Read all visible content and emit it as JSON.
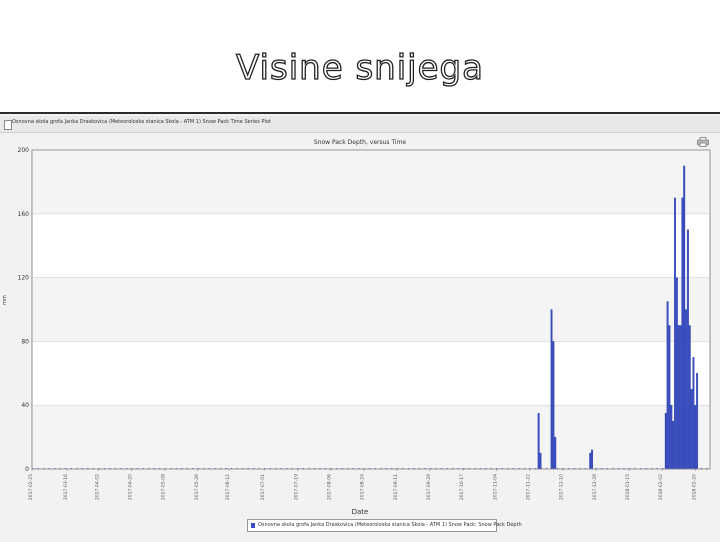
{
  "slide": {
    "title": "Visine snijega"
  },
  "window": {
    "title": "Osnovna skola grofa Janka Draskovica (Meteoroloska stanica Skola - ATM 1) Snow Pack Time Series Plot"
  },
  "colors": {
    "bar": "#3a4fc7",
    "grid": "#dcdcdc",
    "band": "#f4f4f4"
  },
  "icons": {
    "print": "print-icon",
    "window": "document-icon"
  },
  "chart_data": {
    "type": "bar",
    "title": "Snow Pack Depth, versus Time",
    "xlabel": "Date",
    "ylabel": "mm",
    "ylim": [
      0,
      200
    ],
    "yticks": [
      0,
      40,
      80,
      120,
      160,
      200
    ],
    "grid": true,
    "legend_position": "bottom-center",
    "xlim": [
      "2017-02-25",
      "2018-02-28"
    ],
    "xtick_labels": [
      "2017-02-25",
      "2017-03-16",
      "2017-04-02",
      "2017-04-20",
      "2017-05-08",
      "2017-05-26",
      "2017-06-12",
      "2017-07-01",
      "2017-07-19",
      "2017-08-06",
      "2017-08-24",
      "2017-09-11",
      "2017-09-29",
      "2017-10-17",
      "2017-11-04",
      "2017-11-22",
      "2017-12-10",
      "2017-12-28",
      "2018-01-15",
      "2018-02-02",
      "2018-02-20"
    ],
    "series": [
      {
        "name": "Osnovna skola grofa Janka Draskovica (Meteoroloska stanica Skola - ATM 1) Snow Pack: Snow Pack Depth",
        "x": [
          "2017-11-27",
          "2017-11-28",
          "2017-12-04",
          "2017-12-05",
          "2017-12-06",
          "2017-12-25",
          "2017-12-26",
          "2018-02-04",
          "2018-02-05",
          "2018-02-06",
          "2018-02-07",
          "2018-02-08",
          "2018-02-09",
          "2018-02-10",
          "2018-02-11",
          "2018-02-12",
          "2018-02-13",
          "2018-02-14",
          "2018-02-15",
          "2018-02-16",
          "2018-02-17",
          "2018-02-18",
          "2018-02-19",
          "2018-02-20",
          "2018-02-21"
        ],
        "values": [
          35,
          10,
          100,
          80,
          20,
          10,
          12,
          35,
          105,
          90,
          40,
          30,
          170,
          120,
          90,
          90,
          170,
          190,
          100,
          150,
          90,
          50,
          70,
          40,
          60
        ]
      }
    ]
  }
}
